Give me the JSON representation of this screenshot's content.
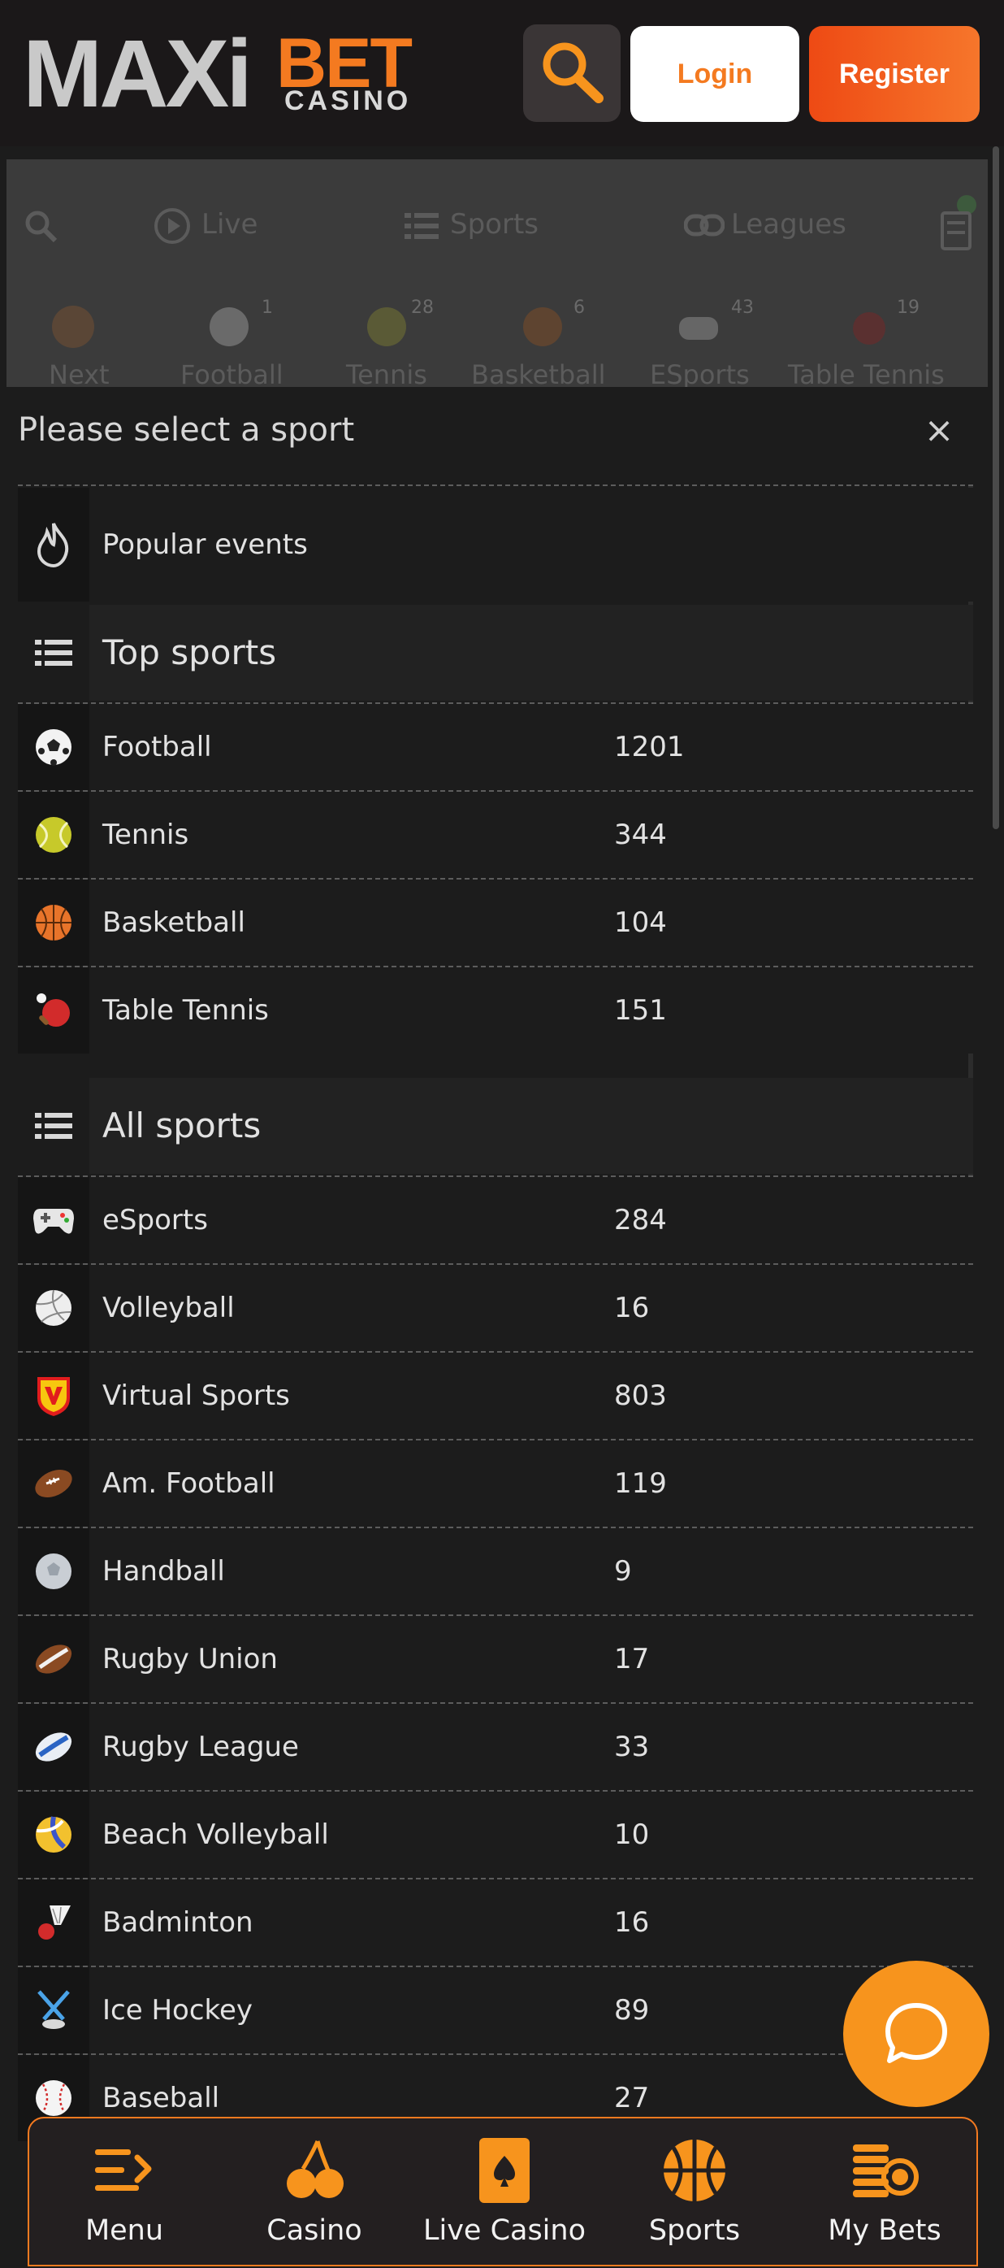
{
  "header": {
    "logo": {
      "part1": "MAXi",
      "part2": "BET",
      "part3": "CASINO"
    },
    "login_label": "Login",
    "register_label": "Register"
  },
  "bg_nav": {
    "items": [
      "Live",
      "Sports",
      "Leagues"
    ],
    "chips": [
      {
        "label": "Next",
        "count": ""
      },
      {
        "label": "Football",
        "count": "1"
      },
      {
        "label": "Tennis",
        "count": "28"
      },
      {
        "label": "Basketball",
        "count": "6"
      },
      {
        "label": "ESports",
        "count": "43"
      },
      {
        "label": "Table Tennis",
        "count": "19"
      }
    ]
  },
  "drawer": {
    "title": "Please select a sport",
    "popular_label": "Popular events",
    "top_sports_label": "Top sports",
    "top_sports": [
      {
        "name": "Football",
        "count": "1201",
        "icon": "football-icon"
      },
      {
        "name": "Tennis",
        "count": "344",
        "icon": "tennis-icon"
      },
      {
        "name": "Basketball",
        "count": "104",
        "icon": "basketball-icon"
      },
      {
        "name": "Table Tennis",
        "count": "151",
        "icon": "table-tennis-icon"
      }
    ],
    "all_sports_label": "All sports",
    "all_sports": [
      {
        "name": "eSports",
        "count": "284",
        "icon": "gamepad-icon"
      },
      {
        "name": "Volleyball",
        "count": "16",
        "icon": "volleyball-icon"
      },
      {
        "name": "Virtual Sports",
        "count": "803",
        "icon": "virtual-sports-icon"
      },
      {
        "name": "Am. Football",
        "count": "119",
        "icon": "american-football-icon"
      },
      {
        "name": "Handball",
        "count": "9",
        "icon": "handball-icon"
      },
      {
        "name": "Rugby Union",
        "count": "17",
        "icon": "rugby-union-icon"
      },
      {
        "name": "Rugby League",
        "count": "33",
        "icon": "rugby-league-icon"
      },
      {
        "name": "Beach Volleyball",
        "count": "10",
        "icon": "beach-volleyball-icon"
      },
      {
        "name": "Badminton",
        "count": "16",
        "icon": "badminton-icon"
      },
      {
        "name": "Ice Hockey",
        "count": "89",
        "icon": "ice-hockey-icon"
      },
      {
        "name": "Baseball",
        "count": "27",
        "icon": "baseball-icon"
      }
    ]
  },
  "bottom_nav": {
    "items": [
      {
        "label": "Menu",
        "icon": "menu-icon"
      },
      {
        "label": "Casino",
        "icon": "cherries-icon"
      },
      {
        "label": "Live Casino",
        "icon": "spade-card-icon"
      },
      {
        "label": "Sports",
        "icon": "basketball-icon"
      },
      {
        "label": "My Bets",
        "icon": "coins-icon"
      }
    ]
  },
  "colors": {
    "accent": "#f47a20",
    "chat": "#f7941d",
    "background": "#1c1c1c"
  }
}
